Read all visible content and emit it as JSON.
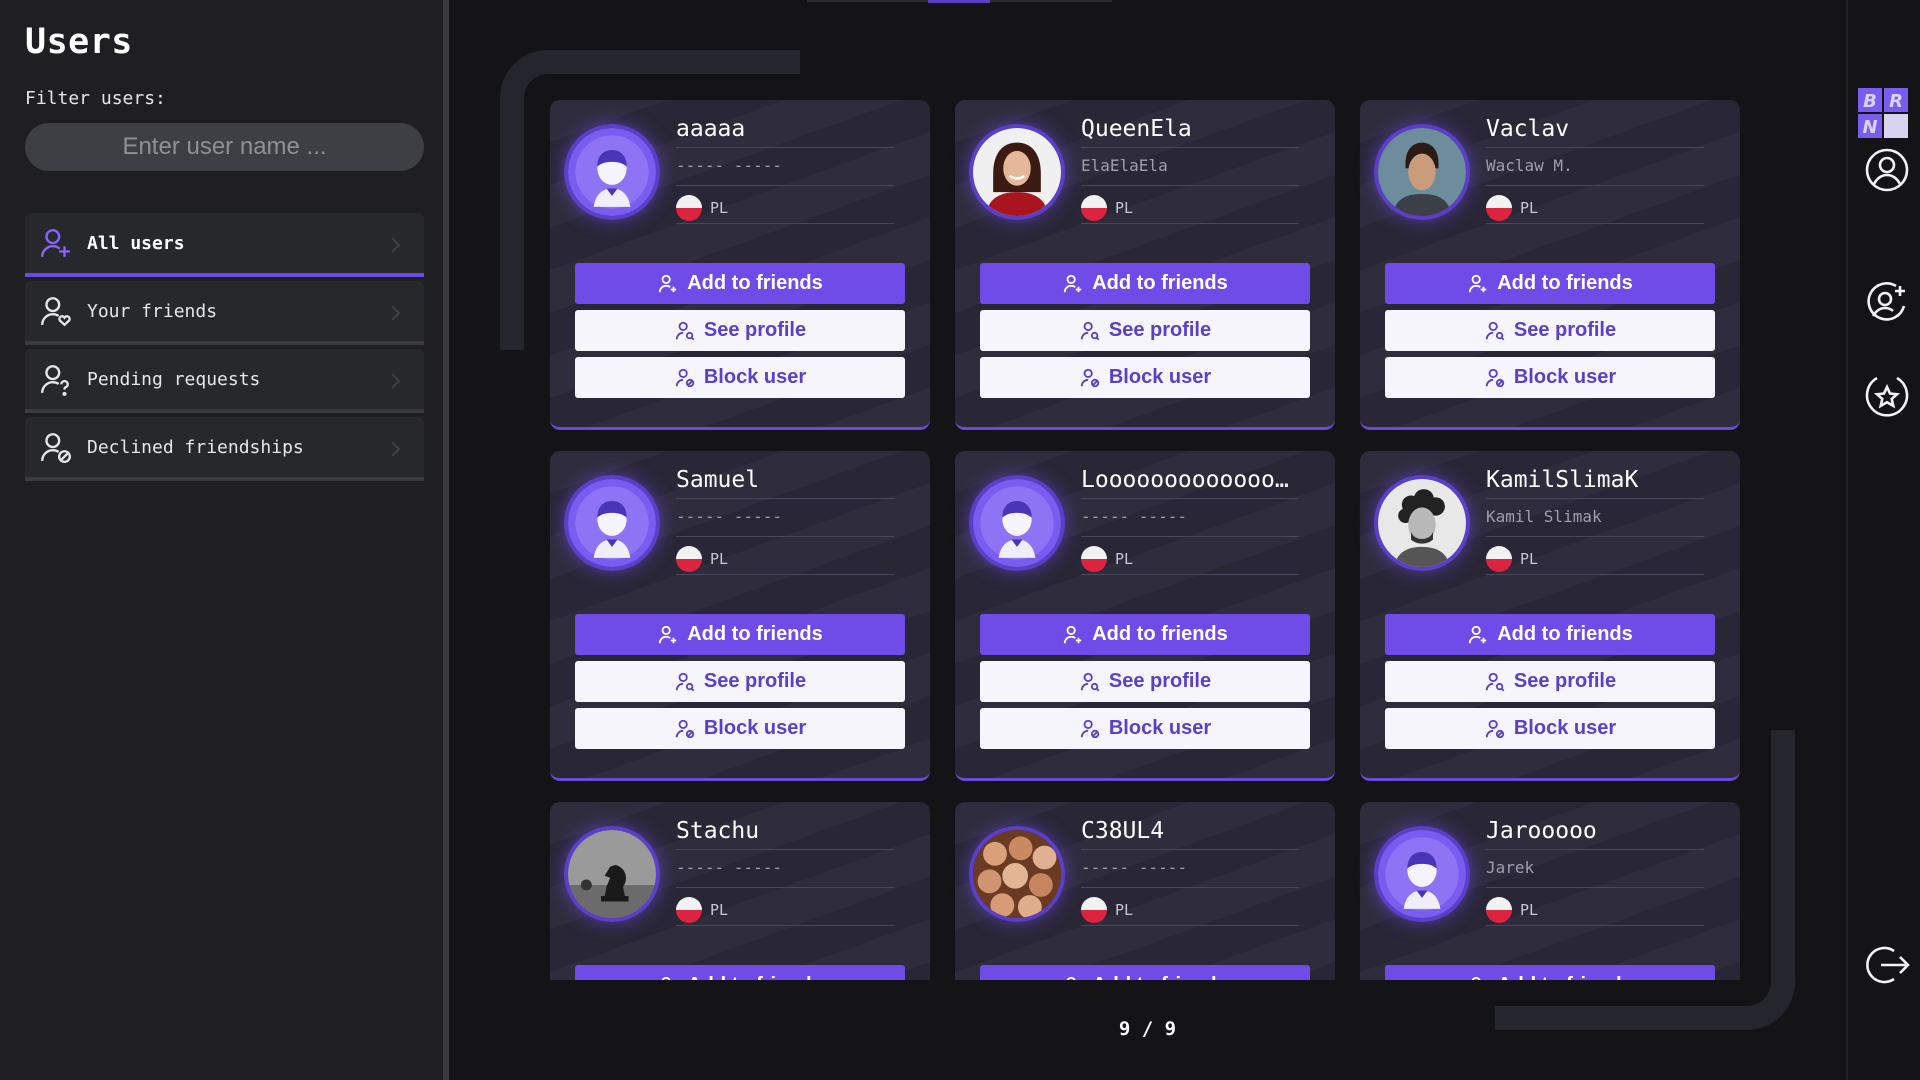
{
  "sidebar": {
    "title": "Users",
    "filter_label": "Filter users:",
    "search_placeholder": "Enter user name ...",
    "search_value": "",
    "nav": [
      {
        "label": "All users",
        "icon": "user-plus-icon",
        "active": true
      },
      {
        "label": "Your friends",
        "icon": "user-heart-icon",
        "active": false
      },
      {
        "label": "Pending requests",
        "icon": "user-question-icon",
        "active": false
      },
      {
        "label": "Declined friendships",
        "icon": "user-block-icon",
        "active": false
      }
    ]
  },
  "buttons": {
    "add": "Add to friends",
    "see": "See profile",
    "block": "Block user"
  },
  "users": [
    {
      "username": "aaaaa",
      "fullname": "----- -----",
      "country": "PL",
      "avatar": "default-avatar"
    },
    {
      "username": "QueenEla",
      "fullname": "ElaElaEla",
      "country": "PL",
      "avatar": "woman-photo"
    },
    {
      "username": "Vaclav",
      "fullname": "Waclaw M.",
      "country": "PL",
      "avatar": "man-photo"
    },
    {
      "username": "Samuel",
      "fullname": "----- -----",
      "country": "PL",
      "avatar": "default-avatar"
    },
    {
      "username": "Looooooooooooo...",
      "fullname": "----- -----",
      "country": "PL",
      "avatar": "default-avatar"
    },
    {
      "username": "KamilSlimaK",
      "fullname": "Kamil Slimak",
      "country": "PL",
      "avatar": "curly-man-photo"
    },
    {
      "username": "Stachu",
      "fullname": "----- -----",
      "country": "PL",
      "avatar": "chess-knight-photo"
    },
    {
      "username": "C38UL4",
      "fullname": "----- -----",
      "country": "PL",
      "avatar": "onions-photo"
    },
    {
      "username": "Jarooooo",
      "fullname": "Jarek",
      "country": "PL",
      "avatar": "default-avatar"
    }
  ],
  "pagination": {
    "text": "9 / 9"
  },
  "rail": {
    "logo_text": "BRN",
    "icons": [
      "profile-icon",
      "add-friend-icon",
      "favorite-star-icon",
      "logout-icon"
    ]
  },
  "colors": {
    "accent": "#6f4be8",
    "card_bg": "#2a2838",
    "sidebar_bg": "#1f1f22"
  }
}
